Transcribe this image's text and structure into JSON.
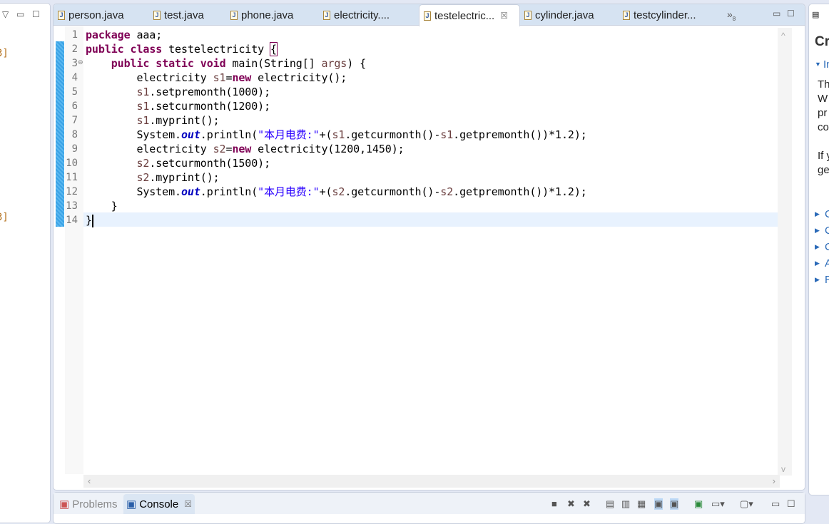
{
  "left_panel": {
    "markers": [
      "3]",
      "3]"
    ],
    "menu_icon": "chevron-down-icon"
  },
  "editor": {
    "tabs": [
      {
        "label": "person.java",
        "active": false
      },
      {
        "label": "test.java",
        "active": false
      },
      {
        "label": "phone.java",
        "active": false
      },
      {
        "label": "electricity....",
        "active": false
      },
      {
        "label": "testelectric...",
        "active": true
      },
      {
        "label": "cylinder.java",
        "active": false
      },
      {
        "label": "testcylinder...",
        "active": false
      }
    ],
    "overflow_label": "»",
    "overflow_count": "8",
    "lines": [
      [
        [
          "kw",
          "package"
        ],
        [
          "t",
          " aaa;"
        ]
      ],
      [
        [
          "kw",
          "public"
        ],
        [
          "t",
          " "
        ],
        [
          "kw",
          "class"
        ],
        [
          "t",
          " testelectricity "
        ],
        [
          "brace",
          "{"
        ]
      ],
      [
        [
          "t",
          "    "
        ],
        [
          "kw",
          "public"
        ],
        [
          "t",
          " "
        ],
        [
          "kw",
          "static"
        ],
        [
          "t",
          " "
        ],
        [
          "kw",
          "void"
        ],
        [
          "t",
          " main(String[] "
        ],
        [
          "var",
          "args"
        ],
        [
          "t",
          ") {"
        ]
      ],
      [
        [
          "t",
          "        electricity "
        ],
        [
          "var",
          "s1"
        ],
        [
          "t",
          "="
        ],
        [
          "kw",
          "new"
        ],
        [
          "t",
          " electricity();"
        ]
      ],
      [
        [
          "t",
          "        "
        ],
        [
          "var",
          "s1"
        ],
        [
          "t",
          ".setpremonth(1000);"
        ]
      ],
      [
        [
          "t",
          "        "
        ],
        [
          "var",
          "s1"
        ],
        [
          "t",
          ".setcurmonth(1200);"
        ]
      ],
      [
        [
          "t",
          "        "
        ],
        [
          "var",
          "s1"
        ],
        [
          "t",
          ".myprint();"
        ]
      ],
      [
        [
          "t",
          "        System."
        ],
        [
          "fld",
          "out"
        ],
        [
          "t",
          ".println("
        ],
        [
          "str",
          "\"本月电费:\""
        ],
        [
          "t",
          "+("
        ],
        [
          "var",
          "s1"
        ],
        [
          "t",
          ".getcurmonth()-"
        ],
        [
          "var",
          "s1"
        ],
        [
          "t",
          ".getpremonth())*1.2);"
        ]
      ],
      [
        [
          "t",
          "        electricity "
        ],
        [
          "var",
          "s2"
        ],
        [
          "t",
          "="
        ],
        [
          "kw",
          "new"
        ],
        [
          "t",
          " electricity(1200,1450);"
        ]
      ],
      [
        [
          "t",
          "        "
        ],
        [
          "var",
          "s2"
        ],
        [
          "t",
          ".setcurmonth(1500);"
        ]
      ],
      [
        [
          "t",
          "        "
        ],
        [
          "var",
          "s2"
        ],
        [
          "t",
          ".myprint();"
        ]
      ],
      [
        [
          "t",
          "        System."
        ],
        [
          "fld",
          "out"
        ],
        [
          "t",
          ".println("
        ],
        [
          "str",
          "\"本月电费:\""
        ],
        [
          "t",
          "+("
        ],
        [
          "var",
          "s2"
        ],
        [
          "t",
          ".getcurmonth()-"
        ],
        [
          "var",
          "s2"
        ],
        [
          "t",
          ".getpremonth())*1.2);"
        ]
      ],
      [
        [
          "t",
          "    }"
        ]
      ],
      [
        [
          "t",
          "}"
        ]
      ]
    ]
  },
  "right_panel": {
    "title": "Cr",
    "section": "In",
    "text": [
      "Th",
      "W",
      "pr",
      "co",
      "",
      "If y",
      "ge"
    ],
    "links": [
      "C",
      "C",
      "C",
      "A",
      "R"
    ]
  },
  "bottom": {
    "tabs": [
      {
        "label": "Problems",
        "active": false
      },
      {
        "label": "Console",
        "active": true
      }
    ]
  },
  "colors": {
    "keyword": "#7f0055",
    "string": "#2a00ff",
    "field": "#0000c0",
    "variable": "#6a3e3e",
    "current_line": "#e8f2fe"
  }
}
